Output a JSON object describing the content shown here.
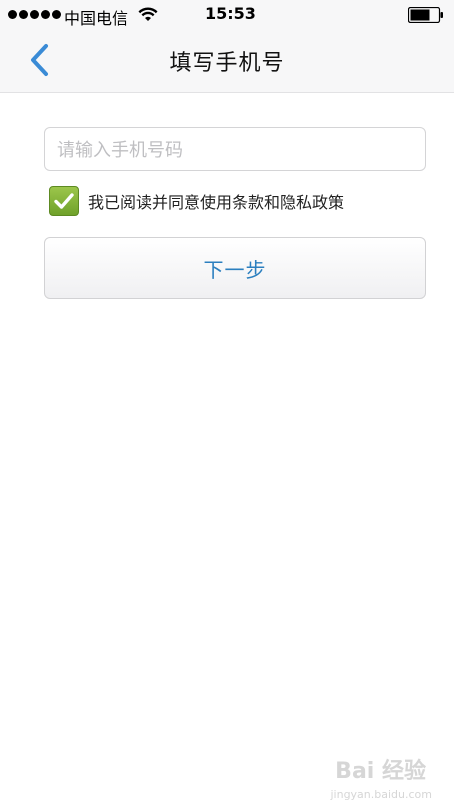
{
  "status_bar": {
    "carrier": "中国电信",
    "time": "15:53"
  },
  "nav": {
    "title": "填写手机号"
  },
  "form": {
    "phone_placeholder": "请输入手机号码",
    "phone_value": "",
    "agree_checked": true,
    "agree_text": "我已阅读并同意使用条款和隐私政策",
    "next_label": "下一步"
  },
  "watermark": {
    "text": "Bai 经验",
    "url": "jingyan.baidu.com"
  },
  "colors": {
    "accent": "#2b7fbf",
    "checkbox_green": "#7fb034",
    "nav_bg": "#f7f7f8"
  }
}
